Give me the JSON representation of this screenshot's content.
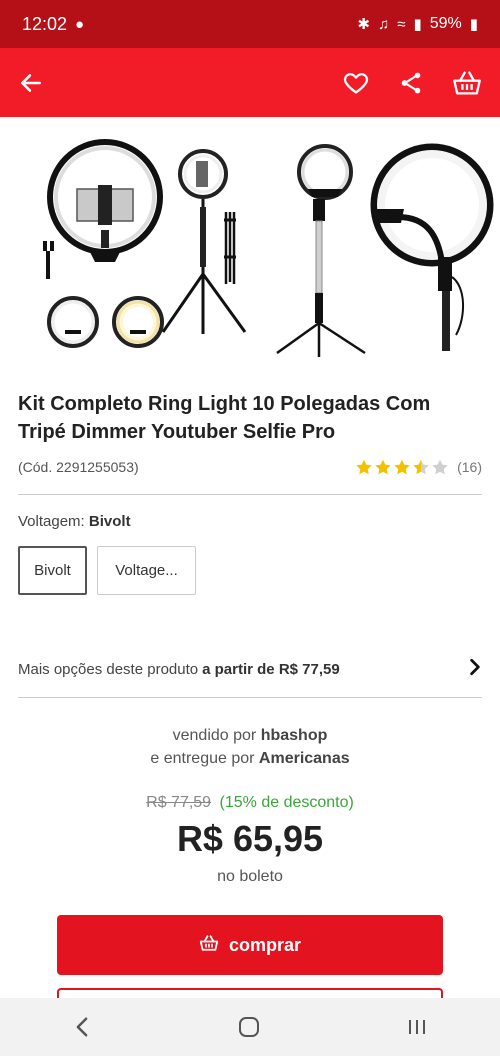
{
  "status_bar": {
    "time": "12:02",
    "battery": "59%"
  },
  "app_bar": {
    "back_icon": "arrow-left-icon",
    "favorite_icon": "heart-icon",
    "share_icon": "share-icon",
    "cart_icon": "basket-icon"
  },
  "product": {
    "title": "Kit Completo Ring Light 10 Polegadas Com Tripé Dimmer Youtuber Selfie Pro",
    "code": "(Cód. 2291255053)",
    "rating": 3.5,
    "rating_max": 5,
    "reviews": "(16)"
  },
  "variant": {
    "label": "Voltagem:",
    "selected": "Bivolt",
    "options": [
      "Bivolt",
      "Voltage..."
    ]
  },
  "more_options": {
    "text": "Mais opções deste produto",
    "price_text": "a partir de R$ 77,59"
  },
  "seller": {
    "sold_by_label": "vendido por",
    "sold_by": "hbashop",
    "delivered_by_label": "e entregue por",
    "delivered_by": "Americanas"
  },
  "pricing": {
    "old_price": "R$ 77,59",
    "discount": "(15% de desconto)",
    "price": "R$ 65,95",
    "payment_note": "no boleto"
  },
  "buy_button": {
    "label": "comprar"
  },
  "colors": {
    "brand_red": "#f21b28",
    "status_red": "#b51018",
    "button_red": "#e3141f",
    "discount_green": "#3aa63a",
    "star_gold": "#f2c200"
  }
}
